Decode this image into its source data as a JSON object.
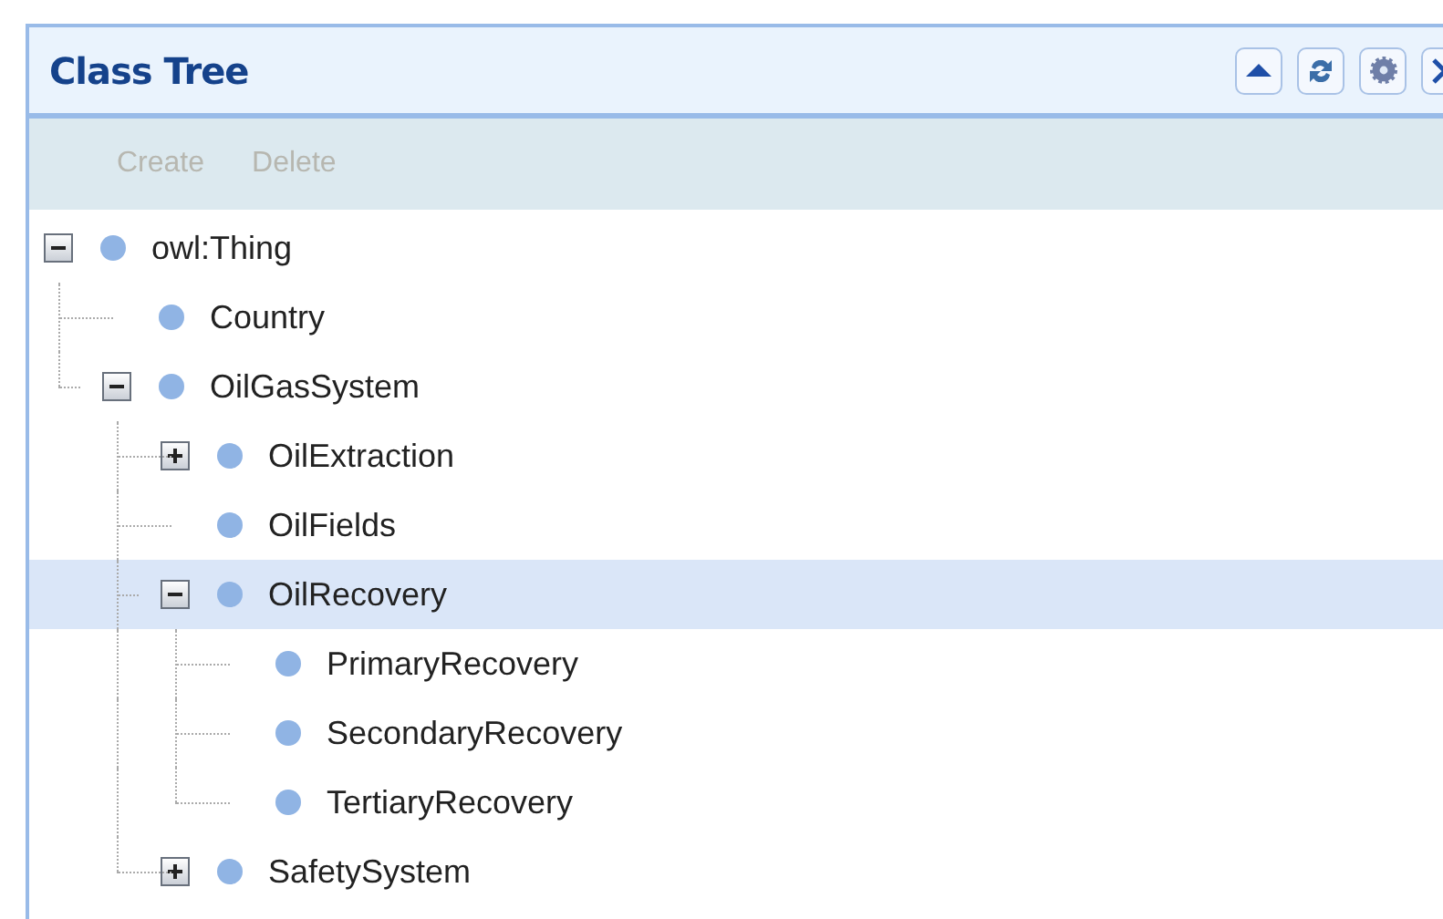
{
  "panel": {
    "title": "Class Tree"
  },
  "tools": [
    {
      "kind": "collapse"
    },
    {
      "kind": "refresh"
    },
    {
      "kind": "settings"
    },
    {
      "kind": "close"
    }
  ],
  "toolbar": [
    {
      "label": "Create",
      "disabled": true
    },
    {
      "label": "Delete",
      "disabled": true
    }
  ],
  "tree": [
    {
      "label": "owl:Thing",
      "expanded": true,
      "selected": false,
      "children": [
        {
          "label": "Country",
          "selected": false
        },
        {
          "label": "OilGasSystem",
          "expanded": true,
          "selected": false,
          "children": [
            {
              "label": "OilExtraction",
              "expanded": false,
              "selected": false
            },
            {
              "label": "OilFields",
              "selected": false
            },
            {
              "label": "OilRecovery",
              "expanded": true,
              "selected": true,
              "children": [
                {
                  "label": "PrimaryRecovery",
                  "selected": false
                },
                {
                  "label": "SecondaryRecovery",
                  "selected": false
                },
                {
                  "label": "TertiaryRecovery",
                  "selected": false
                }
              ]
            },
            {
              "label": "SafetySystem",
              "expanded": false,
              "selected": false
            }
          ]
        }
      ]
    }
  ]
}
